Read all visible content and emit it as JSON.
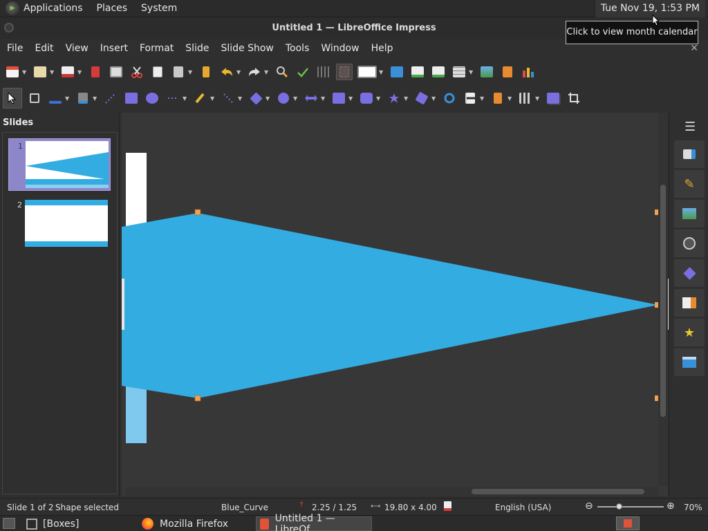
{
  "top_panel": {
    "menus": [
      "Applications",
      "Places",
      "System"
    ],
    "clock": "Tue Nov 19,  1:53 PM"
  },
  "window": {
    "title": "Untitled 1 — LibreOffice Impress",
    "tooltip": "Click to view month calendar",
    "close_doc": "✕"
  },
  "menubar": [
    "File",
    "Edit",
    "View",
    "Insert",
    "Format",
    "Slide",
    "Slide Show",
    "Tools",
    "Window",
    "Help"
  ],
  "slides_pane": {
    "header": "Slides",
    "slides": [
      {
        "number": "1"
      },
      {
        "number": "2"
      }
    ]
  },
  "statusbar": {
    "slide_info": "Slide 1 of 2",
    "selection": "Shape selected",
    "master": "Blue_Curve",
    "position": "2.25 / 1.25",
    "size": "19.80 x 4.00",
    "language": "English (USA)",
    "zoom": "70%"
  },
  "taskbar": {
    "items": [
      "[Boxes]",
      "Mozilla Firefox",
      "Untitled 1 — LibreOf..."
    ]
  },
  "colors": {
    "shape_fill": "#33ace2",
    "thumb_active": "#8d87c9",
    "handle": "#f0a050"
  }
}
